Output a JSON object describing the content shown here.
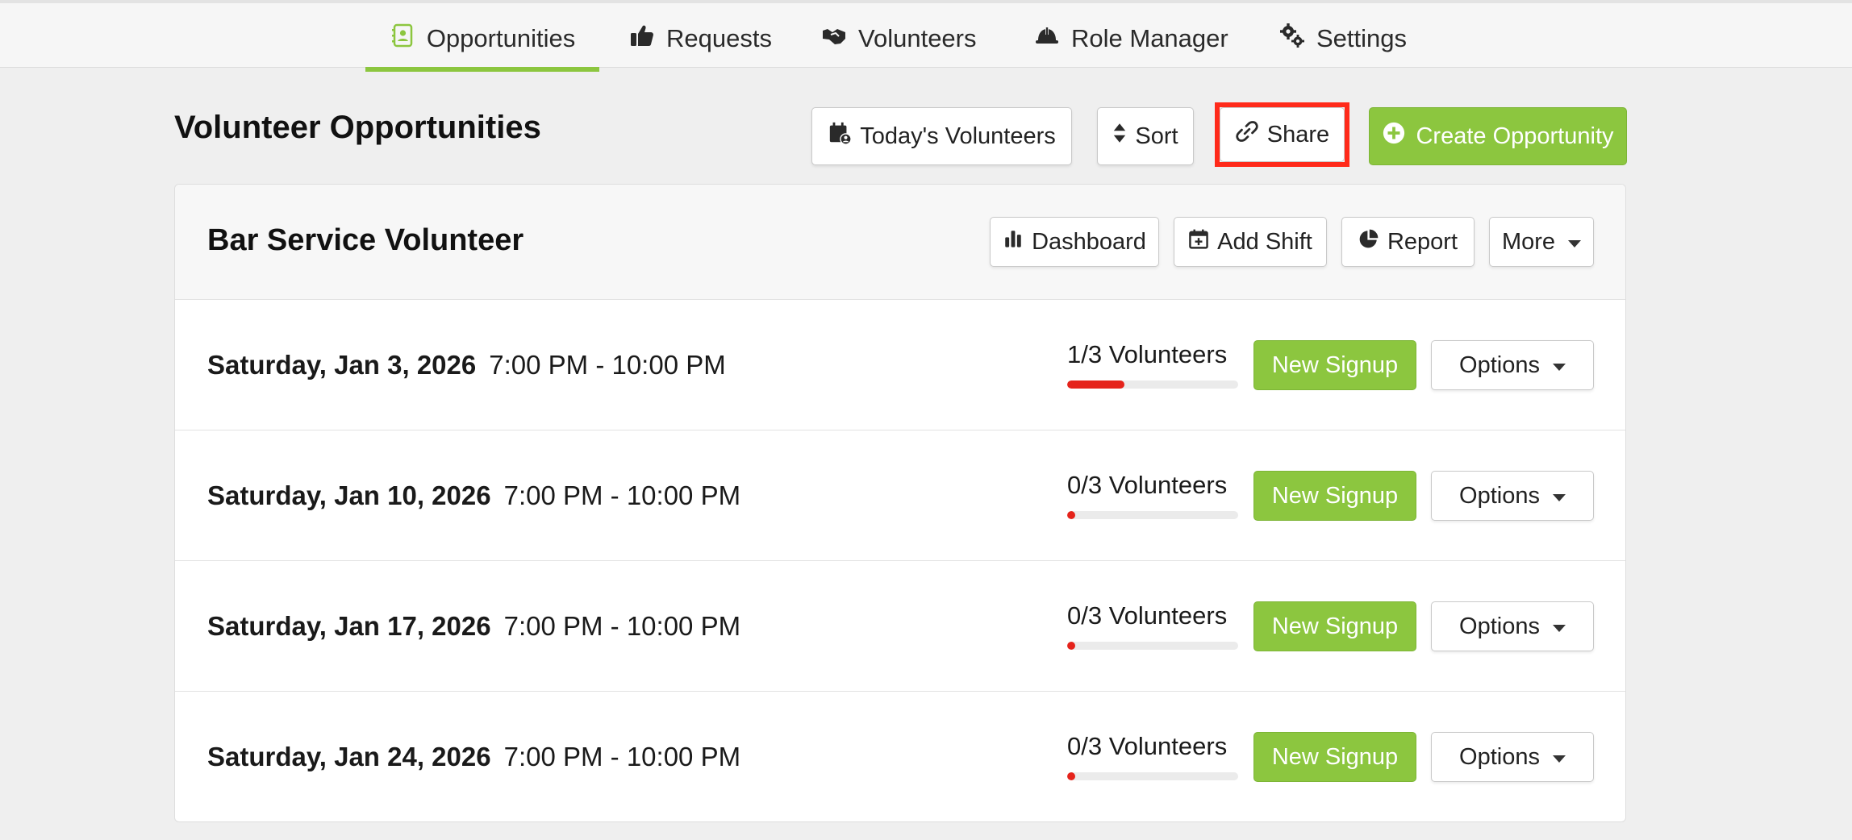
{
  "nav": {
    "tabs": [
      {
        "label": "Opportunities",
        "icon": "contact-book-icon",
        "active": true
      },
      {
        "label": "Requests",
        "icon": "thumbs-up-icon",
        "active": false
      },
      {
        "label": "Volunteers",
        "icon": "handshake-icon",
        "active": false
      },
      {
        "label": "Role Manager",
        "icon": "hard-hat-icon",
        "active": false
      },
      {
        "label": "Settings",
        "icon": "gears-icon",
        "active": false
      }
    ]
  },
  "header": {
    "title": "Volunteer Opportunities",
    "todays_volunteers_label": "Today's Volunteers",
    "sort_label": "Sort",
    "share_label": "Share",
    "create_label": "Create Opportunity"
  },
  "opportunity": {
    "title": "Bar Service Volunteer",
    "dashboard_label": "Dashboard",
    "add_shift_label": "Add Shift",
    "report_label": "Report",
    "more_label": "More",
    "shifts": [
      {
        "date": "Saturday, Jan 3, 2026",
        "time": "7:00 PM - 10:00 PM",
        "volunteers": "1/3 Volunteers",
        "fill": 0.333,
        "signup_label": "New Signup",
        "options_label": "Options"
      },
      {
        "date": "Saturday, Jan 10, 2026",
        "time": "7:00 PM - 10:00 PM",
        "volunteers": "0/3 Volunteers",
        "fill": 0,
        "signup_label": "New Signup",
        "options_label": "Options"
      },
      {
        "date": "Saturday, Jan 17, 2026",
        "time": "7:00 PM - 10:00 PM",
        "volunteers": "0/3 Volunteers",
        "fill": 0,
        "signup_label": "New Signup",
        "options_label": "Options"
      },
      {
        "date": "Saturday, Jan 24, 2026",
        "time": "7:00 PM - 10:00 PM",
        "volunteers": "0/3 Volunteers",
        "fill": 0,
        "signup_label": "New Signup",
        "options_label": "Options"
      }
    ]
  },
  "colors": {
    "accent": "#8cc63f",
    "progress": "#e5231b",
    "highlight": "#ff2a1a"
  }
}
